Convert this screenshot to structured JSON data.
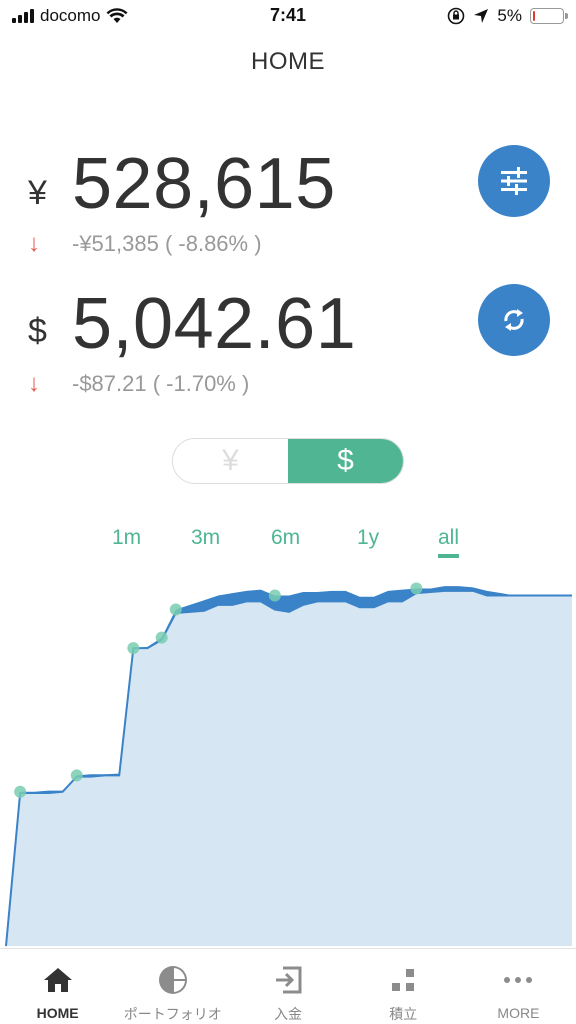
{
  "status_bar": {
    "carrier": "docomo",
    "time": "7:41",
    "battery_text": "5%",
    "battery_level": 0.05
  },
  "header": {
    "title": "HOME"
  },
  "balances": [
    {
      "currency": "¥",
      "amount": "528,615",
      "change": "-¥51,385 ( -8.86% )",
      "button_icon": "sliders-icon"
    },
    {
      "currency": "$",
      "amount": "5,042.61",
      "change": "-$87.21 ( -1.70% )",
      "button_icon": "refresh-icon"
    }
  ],
  "toggle": {
    "yen_label": "¥",
    "usd_label": "$",
    "selected": "usd"
  },
  "range_tabs": [
    {
      "label": "1m"
    },
    {
      "label": "3m"
    },
    {
      "label": "6m"
    },
    {
      "label": "1y"
    },
    {
      "label": "all",
      "active": true
    }
  ],
  "chart_data": {
    "type": "area",
    "title": "",
    "xlabel": "",
    "ylabel": "",
    "grid": false,
    "legend": "none",
    "colors": {
      "line": "#3a83c8",
      "fill": "#d6e6f3",
      "marker": "#79cdb2"
    },
    "x": [
      0,
      1,
      2,
      3,
      4,
      5,
      6,
      7,
      8,
      9,
      10,
      11,
      12,
      13,
      14,
      15,
      16,
      17,
      18,
      19,
      20,
      21,
      22,
      23,
      24,
      25,
      26,
      27,
      28,
      29,
      30,
      31,
      32,
      33,
      34,
      35,
      36,
      37,
      38,
      39,
      40
    ],
    "series": [
      {
        "values": [
          0,
          1310,
          1310,
          1310,
          1320,
          1450,
          1450,
          1460,
          1460,
          2550,
          2550,
          2620,
          2850,
          2860,
          2870,
          2920,
          2920,
          2950,
          2950,
          2880,
          2860,
          2920,
          2950,
          2950,
          2950,
          2900,
          2900,
          2950,
          2950,
          3020,
          3030,
          3040,
          3040,
          3040,
          3000,
          3000,
          3000,
          3000,
          3000,
          3000,
          3000
        ]
      },
      {
        "values": [
          0,
          1320,
          1320,
          1330,
          1330,
          1460,
          1470,
          1470,
          1475,
          2550,
          2560,
          2640,
          2880,
          2920,
          2960,
          3000,
          3020,
          3040,
          3050,
          3000,
          3000,
          3030,
          3030,
          3040,
          3040,
          2990,
          2990,
          3040,
          3050,
          3060,
          3060,
          3080,
          3080,
          3070,
          3040,
          3020,
          3000,
          3000,
          3000,
          3000,
          3000
        ]
      }
    ],
    "markers": [
      1,
      5,
      9,
      11,
      12,
      19,
      29
    ]
  },
  "bottom_nav": [
    {
      "label": "HOME",
      "icon": "home-icon",
      "active": true
    },
    {
      "label": "ポートフォリオ",
      "icon": "pie-chart-icon"
    },
    {
      "label": "入金",
      "icon": "deposit-icon"
    },
    {
      "label": "積立",
      "icon": "blocks-icon"
    },
    {
      "label": "MORE",
      "icon": "more-icon"
    }
  ]
}
